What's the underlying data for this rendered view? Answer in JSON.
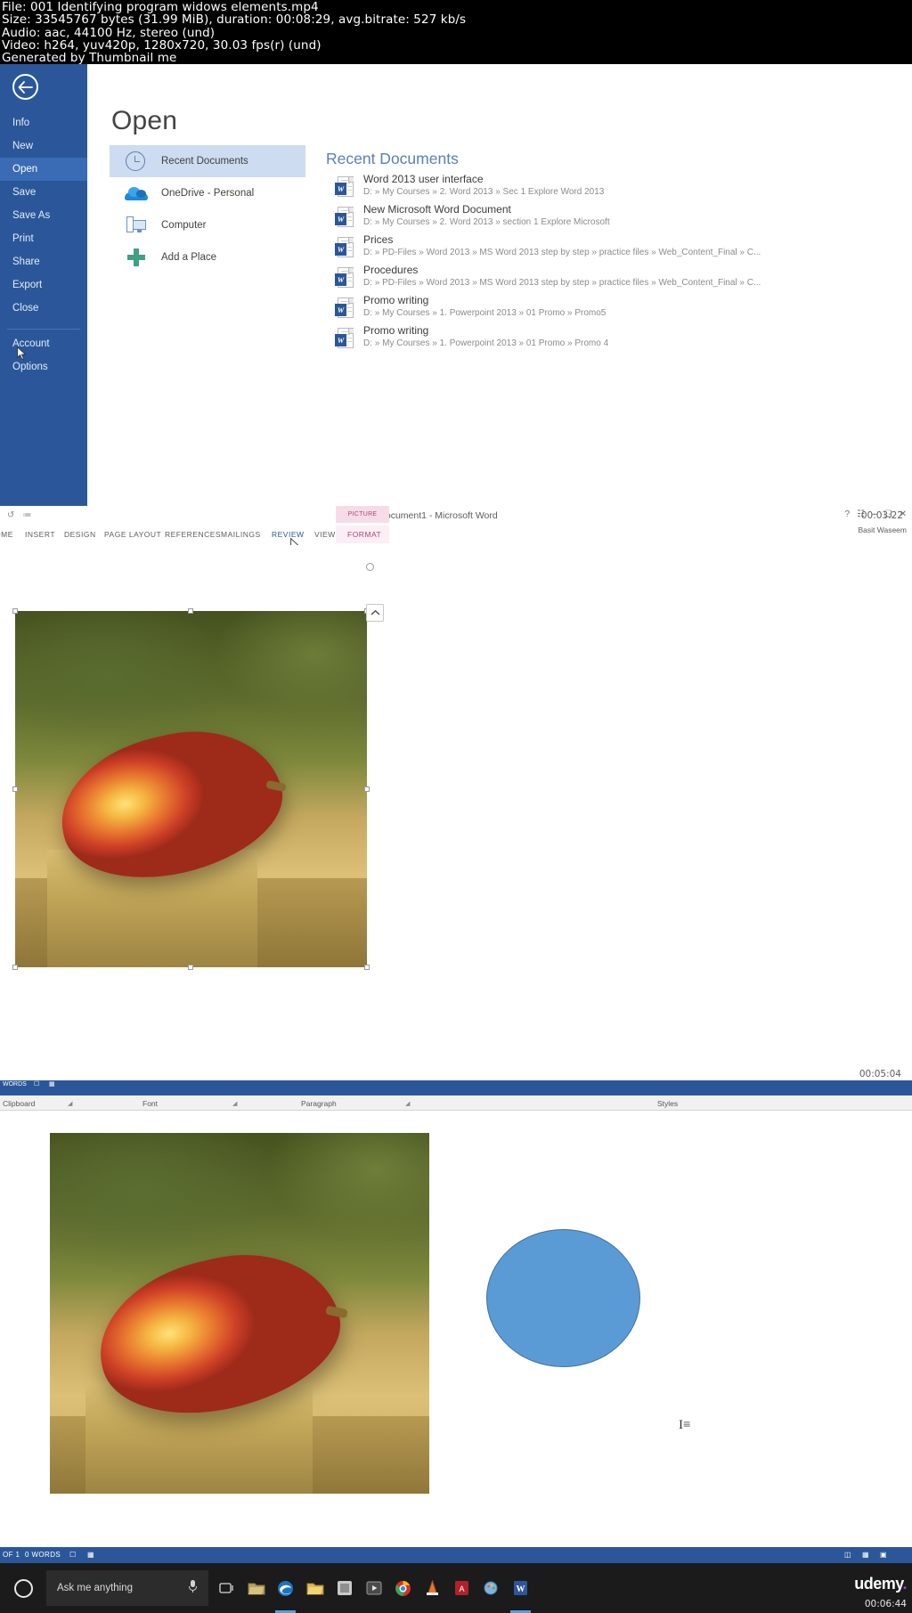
{
  "video_meta": {
    "line1": "File: 001 Identifying program widows elements.mp4",
    "line2": "Size: 33545767 bytes (31.99 MiB), duration: 00:08:29, avg.bitrate: 527 kb/s",
    "line3": "Audio: aac, 44100 Hz, stereo (und)",
    "line4": "Video: h264, yuv420p, 1280x720, 30.03 fps(r) (und)",
    "line5": "Generated by Thumbnail me"
  },
  "backstage": {
    "window_title": "Document1 - Microsoft Word",
    "back_icon": "back-arrow-icon",
    "nav_items": [
      {
        "label": "Info",
        "selected": false
      },
      {
        "label": "New",
        "selected": false
      },
      {
        "label": "Open",
        "selected": true
      },
      {
        "label": "Save",
        "selected": false
      },
      {
        "label": "Save As",
        "selected": false
      },
      {
        "label": "Print",
        "selected": false
      },
      {
        "label": "Share",
        "selected": false
      },
      {
        "label": "Export",
        "selected": false
      },
      {
        "label": "Close",
        "selected": false
      },
      {
        "label": "Account",
        "selected": false
      },
      {
        "label": "Options",
        "selected": false
      }
    ],
    "page_title": "Open",
    "places": [
      {
        "label": "Recent Documents",
        "icon": "clock-icon",
        "selected": true
      },
      {
        "label": "OneDrive - Personal",
        "icon": "cloud-icon",
        "selected": false
      },
      {
        "label": "Computer",
        "icon": "computer-icon",
        "selected": false
      },
      {
        "label": "Add a Place",
        "icon": "plus-icon",
        "selected": false
      }
    ],
    "recent_header": "Recent Documents",
    "recent_documents": [
      {
        "name": "Word 2013 user interface",
        "path": "D: » My Courses » 2. Word 2013 » Sec 1 Explore Word 2013"
      },
      {
        "name": "New Microsoft Word Document",
        "path": "D: » My Courses » 2. Word 2013 » section 1 Explore Microsoft"
      },
      {
        "name": "Prices",
        "path": "D: » PD-Files » Word 2013 » MS Word 2013 step by step » practice files » Web_Content_Final » C..."
      },
      {
        "name": "Procedures",
        "path": "D: » PD-Files » Word 2013 » MS Word 2013 step by step » practice files » Web_Content_Final » C..."
      },
      {
        "name": "Promo writing",
        "path": "D: » My Courses » 1. Powerpoint 2013 » 01 Promo » Promo5"
      },
      {
        "name": "Promo writing",
        "path": "D: » My Courses » 1. Powerpoint 2013 » 01 Promo » Promo 4"
      }
    ]
  },
  "word_mid": {
    "window_title": "Document1 - Microsoft Word",
    "contextual_tab_group": "PICTURE TOOLS",
    "tabs": [
      {
        "label": "OME",
        "state": "clipped"
      },
      {
        "label": "INSERT",
        "state": "normal"
      },
      {
        "label": "DESIGN",
        "state": "normal"
      },
      {
        "label": "PAGE LAYOUT",
        "state": "normal"
      },
      {
        "label": "REFERENCES",
        "state": "normal"
      },
      {
        "label": "MAILINGS",
        "state": "normal"
      },
      {
        "label": "REVIEW",
        "state": "hover"
      },
      {
        "label": "VIEW",
        "state": "normal"
      },
      {
        "label": "FORMAT",
        "state": "contextual"
      }
    ],
    "user_name": "Basit Waseem",
    "help_icon": "question-mark-icon",
    "ribbon_display_icon": "ribbon-display-options-icon",
    "minimize_icon": "minimize-icon",
    "restore_icon": "restore-icon",
    "close_icon": "close-icon",
    "layout_options_icon": "layout-options-icon",
    "timer_top": "00:03:22",
    "timer_bottom": "00:05:04",
    "image_alt": "mango-photo"
  },
  "word_bottom": {
    "ribbon_groups": [
      {
        "label": "Clipboard"
      },
      {
        "label": "Font"
      },
      {
        "label": "Paragraph"
      },
      {
        "label": "Styles"
      }
    ],
    "dialog_launcher_icon": "dialog-launcher-icon",
    "status_left": "OF 1",
    "status_words": "0 WORDS",
    "status_proofing_icon": "proofing-icon",
    "status_language_icon": "language-icon",
    "status_view_icons": [
      "read-mode-icon",
      "print-layout-icon",
      "web-layout-icon"
    ],
    "image_alt": "mango-photo",
    "shape_alt": "blue-ellipse-shape",
    "text_cursor": "I-beam-text-cursor"
  },
  "word_mid_status": {
    "words": "WORDS",
    "proofing_icon": "proofing-icon",
    "language_icon": "language-icon"
  },
  "taskbar": {
    "start_icon": "cortana-circle-icon",
    "search_placeholder": "Ask me anything",
    "mic_icon": "microphone-icon",
    "items": [
      {
        "icon": "task-view-icon",
        "name": "task-view",
        "active": false
      },
      {
        "icon": "file-explorer-folder-icon",
        "name": "explorer-pinned",
        "active": false
      },
      {
        "icon": "edge-icon",
        "name": "microsoft-edge",
        "active": true
      },
      {
        "icon": "folder-icon",
        "name": "file-explorer",
        "active": false
      },
      {
        "icon": "store-icon",
        "name": "windows-store",
        "active": false
      },
      {
        "icon": "media-icon",
        "name": "media-player",
        "active": false
      },
      {
        "icon": "chrome-icon",
        "name": "google-chrome-1",
        "active": false
      },
      {
        "icon": "chrome-icon",
        "name": "google-chrome-2",
        "active": false
      },
      {
        "icon": "cone-icon",
        "name": "vlc-player",
        "active": false
      },
      {
        "icon": "pdf-icon",
        "name": "adobe-reader",
        "active": false
      },
      {
        "icon": "paint-icon",
        "name": "paint",
        "active": false
      },
      {
        "icon": "word-icon",
        "name": "microsoft-word",
        "active": true
      }
    ],
    "clock": "00:06:44",
    "brand": "udemy",
    "brand_dot": "."
  },
  "colors": {
    "word_blue": "#2b579a",
    "accent_blue": "#3a6bb5",
    "selection_blue": "#cddcf0",
    "picture_tools_pink": "#b0447a",
    "shape_fill": "#5b9bd5",
    "shape_stroke": "#41719c",
    "taskbar_bg": "#1b1b1b",
    "udemy_purple": "#a435f0"
  }
}
